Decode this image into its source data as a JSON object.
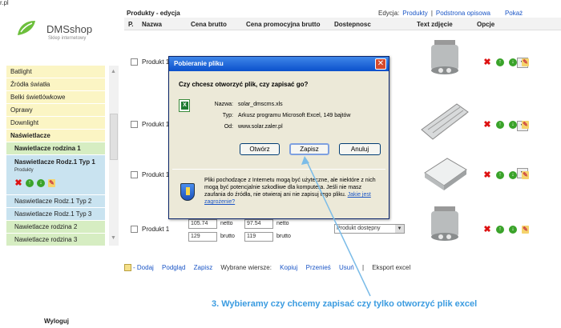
{
  "corner_text": "r.pl",
  "logo": {
    "brand": "DMSshop",
    "tagline": "Sklep internetowy"
  },
  "sidebar": {
    "items": [
      {
        "label": "Batlight",
        "style": "yellow"
      },
      {
        "label": "Źródła światła",
        "style": "yellow"
      },
      {
        "label": "Belki świetlówkowe",
        "style": "yellow"
      },
      {
        "label": "Oprawy",
        "style": "yellow"
      },
      {
        "label": "Downlight",
        "style": "yellow"
      },
      {
        "label": "Naświetlacze",
        "style": "yellow"
      },
      {
        "label": "Nawietlacze rodzina 1",
        "style": "green"
      }
    ],
    "active": {
      "title": "Naswietlacze Rodz.1 Typ 1",
      "sub": "Produkty"
    },
    "items_after": [
      {
        "label": "Naswietlacze Rodz.1 Typ 2",
        "style": "blue"
      },
      {
        "label": "Naswietlacze Rodz.1 Typ 3",
        "style": "blue"
      },
      {
        "label": "Nawietlacze rodzina 2",
        "style": "green"
      },
      {
        "label": "Nawietlacze rodzina 3",
        "style": "green"
      }
    ],
    "logout": "Wyloguj"
  },
  "main": {
    "title": "Produkty - edycja",
    "toplinks": [
      "Edycja:",
      "Produkty",
      "|",
      "Podstrona opisowa",
      "Pokaż wyszukiwarkę"
    ],
    "columns": [
      "P.",
      "Nazwa",
      "Cena brutto",
      "Cena promocyjna brutto",
      "Dostepnosc",
      "Text zdjęcie",
      "Opcje"
    ],
    "rows": [
      {
        "name": "Produkt 1"
      },
      {
        "name": "Produkt 1"
      },
      {
        "name": "Produkt 1"
      },
      {
        "name": "Produkt 1",
        "price_netto": "105.74",
        "price_brutto": "129",
        "promo_netto": "97.54",
        "promo_brutto": "119",
        "netto_label": "netto",
        "brutto_label": "brutto",
        "availability": "Produkt dostępny"
      }
    ],
    "footer": [
      "- Dodaj",
      "Podgląd",
      "Zapisz",
      "Wybrane wiersze:",
      "Kopiuj",
      "Przenieś",
      "Usuń",
      "|",
      "Eksport excel"
    ]
  },
  "dialog": {
    "title": "Pobieranie pliku",
    "question": "Czy chcesz otworzyć plik, czy zapisać go?",
    "name_label": "Nazwa:",
    "name": "solar_dmscms.xls",
    "type_label": "Typ:",
    "type": "Arkusz programu Microsoft Excel, 149 bajtów",
    "from_label": "Od:",
    "from": "www.solar.zaler.pl",
    "open": "Otwórz",
    "save": "Zapisz",
    "cancel": "Anuluj",
    "warning": "Pliki pochodzące z Internetu mogą być użyteczne, ale niektóre z nich mogą być potencjalnie szkodliwe dla komputera. Jeśli nie masz zaufania do źródła, nie otwieraj ani nie zapisuj tego pliku.",
    "warning_link": "Jakie jest zagrożenie?"
  },
  "annotation": "3. Wybieramy czy chcemy zapisać czy tylko otworzyć plik excel",
  "colors": {
    "accent": "#3a9be0",
    "dialog_title": "#0b50cc"
  }
}
